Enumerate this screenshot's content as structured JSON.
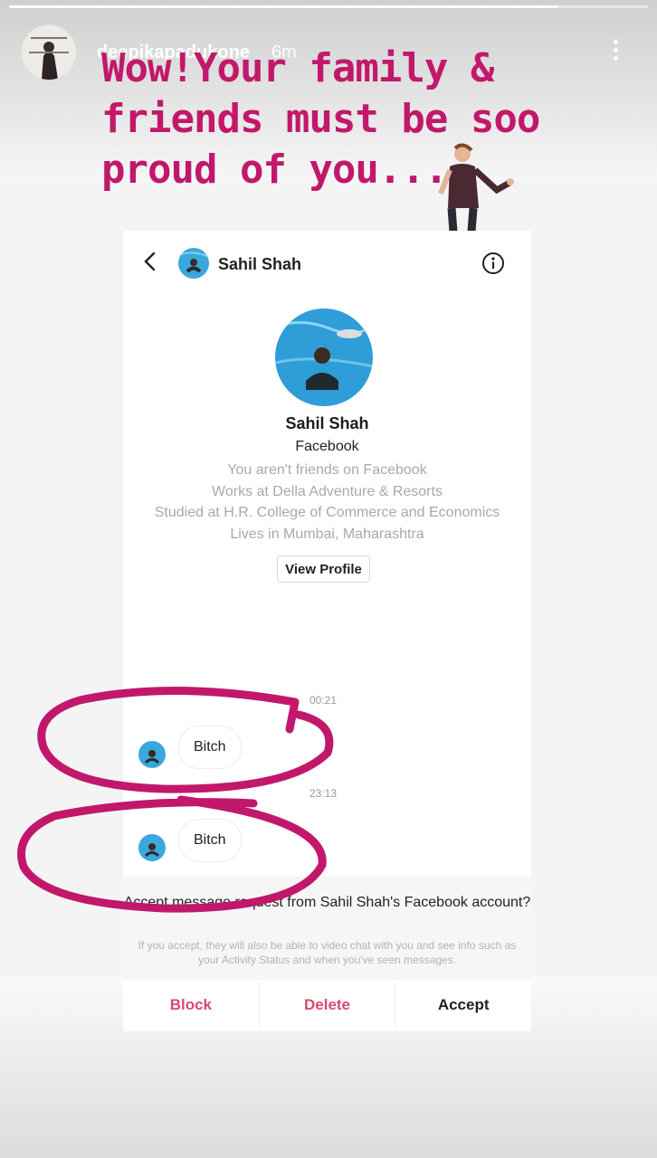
{
  "story": {
    "username": "deepikapadukone",
    "time_ago": "6m",
    "progress": 0.86,
    "avatar_logo_text": "DEEPIKA PADUKONE",
    "caption": "Wow!Your family & friends must be soo proud of you..."
  },
  "chat": {
    "header": {
      "name": "Sahil Shah"
    },
    "profile": {
      "name": "Sahil Shah",
      "platform": "Facebook",
      "details": [
        "You aren't friends on Facebook",
        "Works at Della Adventure & Resorts",
        "Studied at H.R. College of Commerce and Economics",
        "Lives in Mumbai, Maharashtra"
      ],
      "view_profile_label": "View Profile"
    },
    "messages": [
      {
        "time": "00:21",
        "text": "Bitch"
      },
      {
        "time": "23:13",
        "text": "Bitch"
      }
    ],
    "request": {
      "title": "Accept message request from Sahil Shah's Facebook account?",
      "subtitle": "If you accept, they will also be able to video chat with you and see info such as your Activity Status and when you've seen messages."
    },
    "actions": {
      "block": "Block",
      "delete": "Delete",
      "accept": "Accept"
    }
  },
  "colors": {
    "annotation": "#c2186b",
    "block_delete": "#d94a6e",
    "pool_blue": "#3aa8dc"
  },
  "icons": [
    "more-icon",
    "back-chevron-icon",
    "info-icon"
  ]
}
